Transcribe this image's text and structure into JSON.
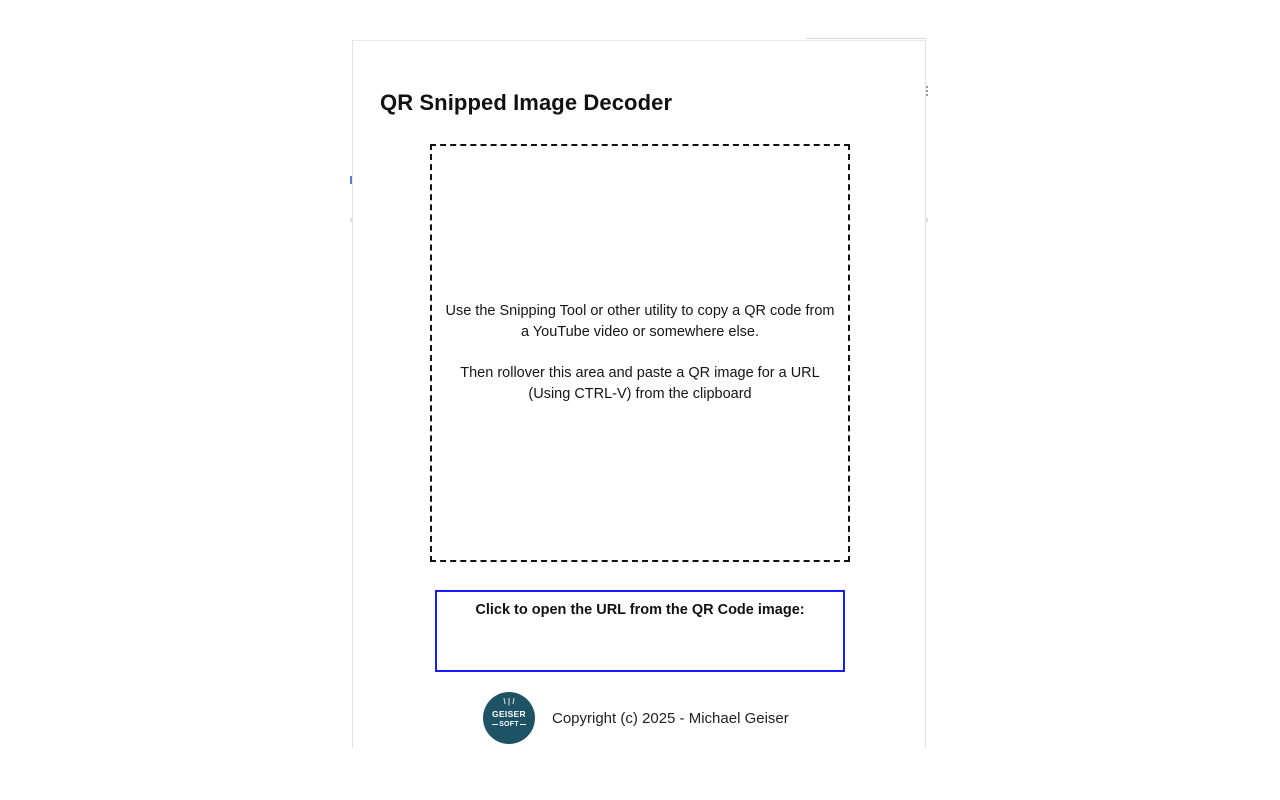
{
  "popup": {
    "title": "QR Snipped Image Decoder"
  },
  "drop_zone": {
    "instruction_line_1": "Use the Snipping Tool or other utility to copy a QR code from a YouTube video or somewhere else.",
    "instruction_line_2": "Then rollover this area and paste a QR image for a URL (Using CTRL-V) from the clipboard"
  },
  "url_box": {
    "label": "Click to open the URL from the QR Code image:",
    "url": ""
  },
  "footer": {
    "logo_line_1": "GEISER",
    "logo_line_2": "SOFT",
    "logo_rays": "\\ | /",
    "copyright": "Copyright (c) 2025 - Michael Geiser"
  },
  "colors": {
    "url_box_border": "#1a1aff",
    "logo_background": "#1d5364",
    "dashed_border": "#111111"
  }
}
